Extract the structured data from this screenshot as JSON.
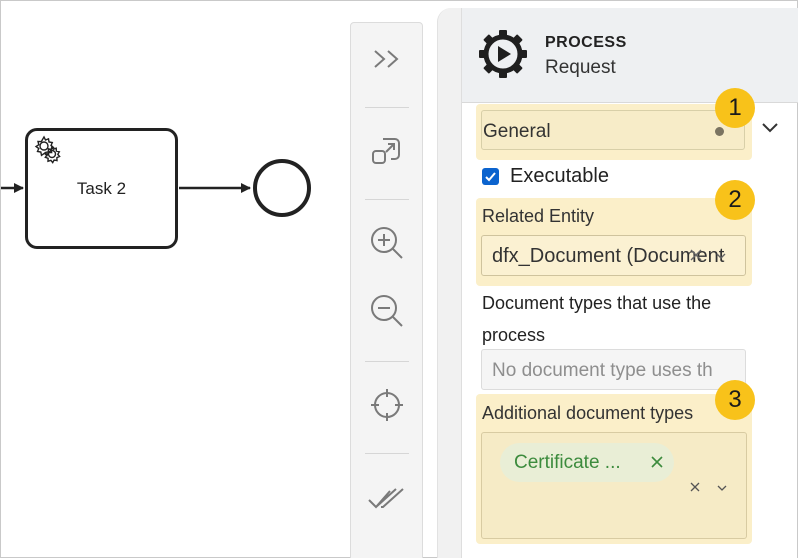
{
  "canvas": {
    "task_label": "Task 2"
  },
  "toolbar": {
    "buttons": [
      {
        "name": "collapse-panel",
        "icon": "double-chevron-right-icon"
      },
      {
        "name": "fit-viewport",
        "icon": "fit-screen-icon"
      },
      {
        "name": "zoom-in",
        "icon": "zoom-in-icon"
      },
      {
        "name": "zoom-out",
        "icon": "zoom-out-icon"
      },
      {
        "name": "center",
        "icon": "crosshair-icon"
      },
      {
        "name": "validate",
        "icon": "double-check-icon"
      }
    ]
  },
  "panel": {
    "element_type": "PROCESS",
    "element_name": "Request",
    "group_label": "General",
    "executable_label": "Executable",
    "executable_checked": true,
    "related_entity_label": "Related Entity",
    "related_entity_value": "dfx_Document (Document",
    "doc_types_label": "Document types that use the process",
    "doc_types_placeholder": "No document type uses th",
    "additional_label": "Additional document types",
    "additional_tag": "Certificate ..."
  },
  "badges": [
    "1",
    "2",
    "3"
  ],
  "colors": {
    "highlight": "#fbefc9",
    "badge": "#f8c21a",
    "checkbox": "#0b63ce",
    "tag_text": "#3c8b3d"
  }
}
